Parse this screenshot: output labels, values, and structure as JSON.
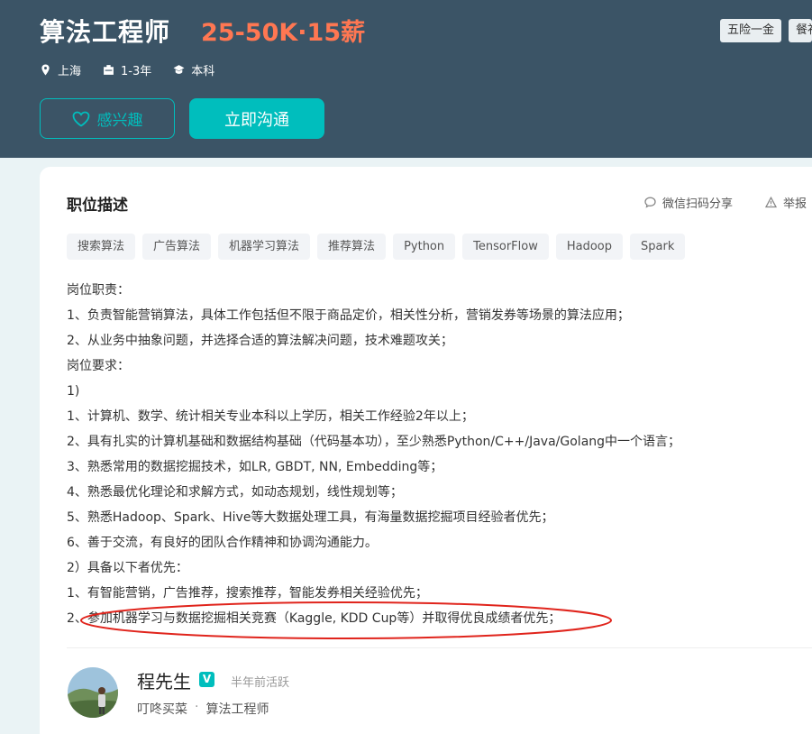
{
  "job": {
    "title": "算法工程师",
    "salary": "25-50K·15薪",
    "benefits": [
      "五险一金",
      "餐补"
    ],
    "location": "上海",
    "experience": "1-3年",
    "education": "本科",
    "interest_label": "感兴趣",
    "chat_label": "立即沟通"
  },
  "detail": {
    "section_title": "职位描述",
    "share_label": "微信扫码分享",
    "report_label": "举报",
    "tags": [
      "搜索算法",
      "广告算法",
      "机器学习算法",
      "推荐算法",
      "Python",
      "TensorFlow",
      "Hadoop",
      "Spark"
    ],
    "lines": [
      "岗位职责：",
      "1、负责智能营销算法，具体工作包括但不限于商品定价，相关性分析，营销发券等场景的算法应用；",
      "2、从业务中抽象问题，并选择合适的算法解决问题，技术难题攻关；",
      "岗位要求：",
      "1)",
      "1、计算机、数学、统计相关专业本科以上学历，相关工作经验2年以上；",
      "2、具有扎实的计算机基础和数据结构基础（代码基本功），至少熟悉Python/C++/Java/Golang中一个语言；",
      "3、熟悉常用的数据挖掘技术，如LR, GBDT, NN, Embedding等；",
      "4、熟悉最优化理论和求解方式，如动态规划，线性规划等；",
      "5、熟悉Hadoop、Spark、Hive等大数据处理工具，有海量数据挖掘项目经验者优先；",
      "6、善于交流，有良好的团队合作精神和协调沟通能力。",
      "2）具备以下者优先：",
      "1、有智能营销，广告推荐，搜索推荐，智能发券相关经验优先；",
      "2、参加机器学习与数据挖掘相关竞赛（Kaggle, KDD Cup等）并取得优良成绩者优先；"
    ]
  },
  "recruiter": {
    "name": "程先生",
    "verified_badge": "V",
    "active_status": "半年前活跃",
    "company": "叮咚买菜",
    "position": "算法工程师"
  },
  "colors": {
    "header_bg": "#3b5466",
    "salary": "#ff7752",
    "accent": "#00bebd",
    "annotation": "#e0241c"
  },
  "icons": [
    "location-icon",
    "briefcase-icon",
    "graduation-cap-icon",
    "heart-icon",
    "wechat-share-icon",
    "warning-icon",
    "verified-icon"
  ]
}
